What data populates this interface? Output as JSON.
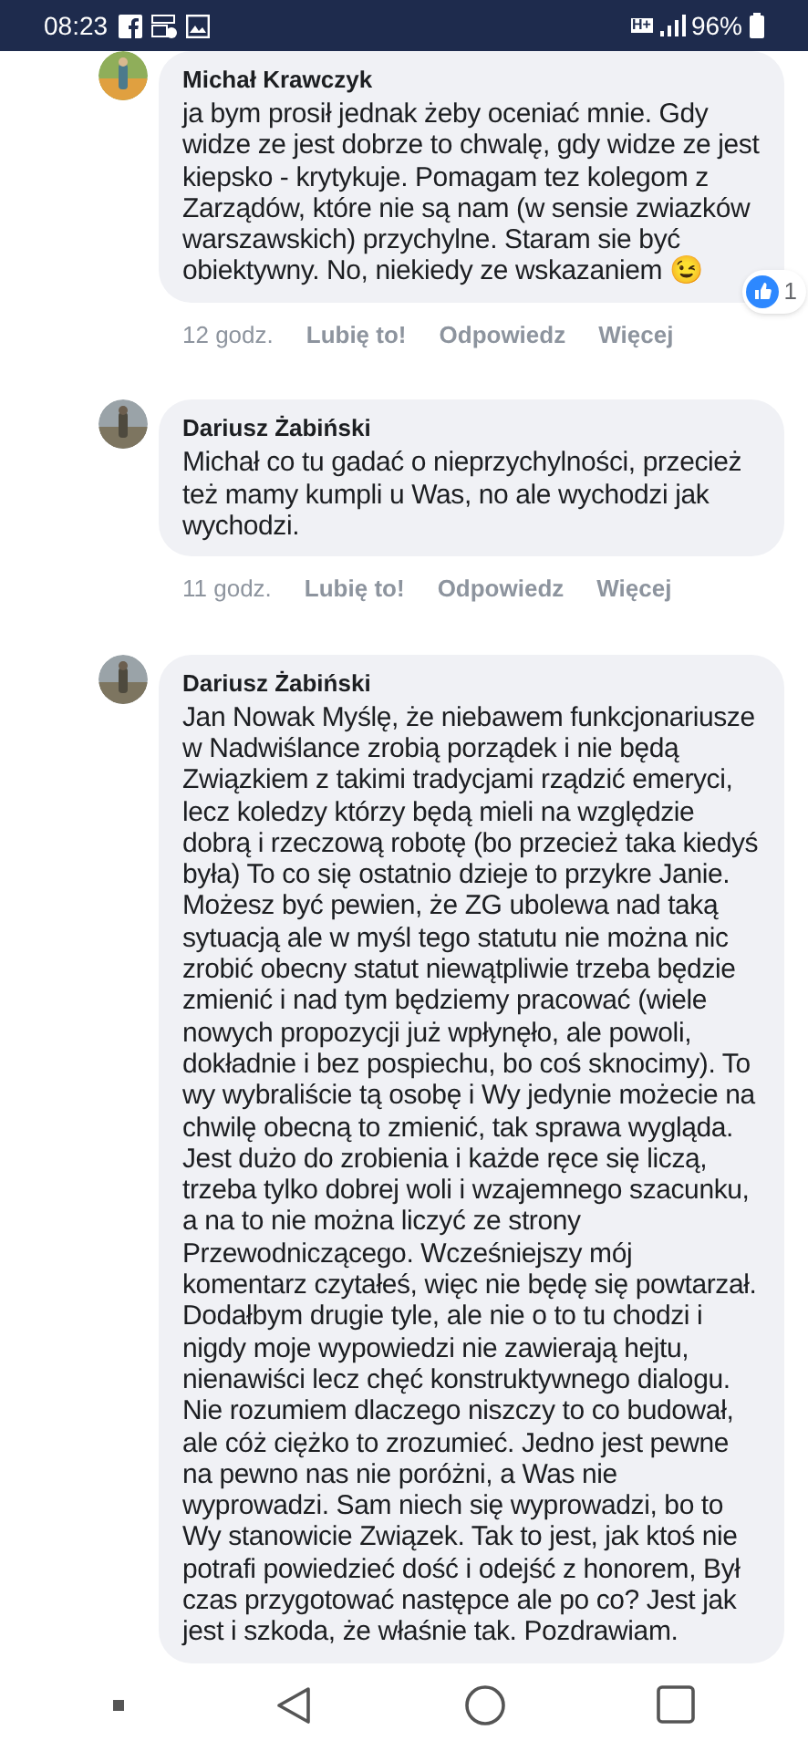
{
  "status_bar": {
    "time": "08:23",
    "network": "H+",
    "battery": "96%"
  },
  "comments": [
    {
      "author": "Michał Krawczyk",
      "text": "ja bym prosił jednak żeby oceniać mnie. Gdy widze ze jest dobrze to chwalę, gdy widze ze jest kiepsko - krytykuje. Pomagam tez kolegom z Zarządów, które nie są nam (w sensie zwiazków warszawskich) przychylne. Staram sie być obiektywny. No, niekiedy ze wskazaniem 😉",
      "reactions": "1",
      "time": "12 godz.",
      "actions": [
        "Lubię to!",
        "Odpowiedz",
        "Więcej"
      ]
    },
    {
      "author": "Dariusz Żabiński",
      "text": "Michał co tu gadać o nieprzychylności, przecież też mamy kumpli u Was, no ale wychodzi jak wychodzi.",
      "time": "11 godz.",
      "actions": [
        "Lubię to!",
        "Odpowiedz",
        "Więcej"
      ]
    },
    {
      "author": "Dariusz Żabiński",
      "text": "Jan Nowak Myślę, że niebawem funkcjonariusze w Nadwiślance zrobią porządek i nie będą Związkiem z takimi tradycjami rządzić emeryci, lecz koledzy którzy będą mieli na względzie dobrą i rzeczową robotę (bo przecież taka kiedyś była) To co się ostatnio dzieje to przykre Janie. Możesz być pewien, że ZG ubolewa nad taką sytuacją ale w myśl tego statutu nie można nic zrobić obecny statut niewątpliwie trzeba będzie zmienić i nad tym będziemy pracować (wiele nowych propozycji już wpłynęło, ale powoli, dokładnie i bez pospiechu, bo coś sknocimy). To wy wybraliście tą osobę i Wy jedynie możecie na chwilę obecną to zmienić, tak sprawa wygląda. Jest dużo do zrobienia i każde ręce się liczą, trzeba tylko dobrej woli i wzajemnego szacunku, a na to nie można liczyć ze strony Przewodniczącego. Wcześniejszy mój komentarz czytałeś, więc nie będę się powtarzał. Dodałbym drugie tyle, ale nie o to tu chodzi i nigdy moje wypowiedzi nie zawierają hejtu, nienawiści lecz chęć konstruktywnego dialogu. Nie rozumiem dlaczego niszczy to co budował, ale cóż ciężko to zrozumieć. Jedno jest pewne na pewno nas nie poróżni, a Was nie wyprowadzi. Sam niech się wyprowadzi, bo to Wy stanowicie Związek. Tak to jest, jak ktoś nie potrafi powiedzieć dość i odejść z honorem, Był czas przygotować następce ale po co? Jest jak jest i szkoda, że właśnie tak. Pozdrawiam."
    }
  ]
}
